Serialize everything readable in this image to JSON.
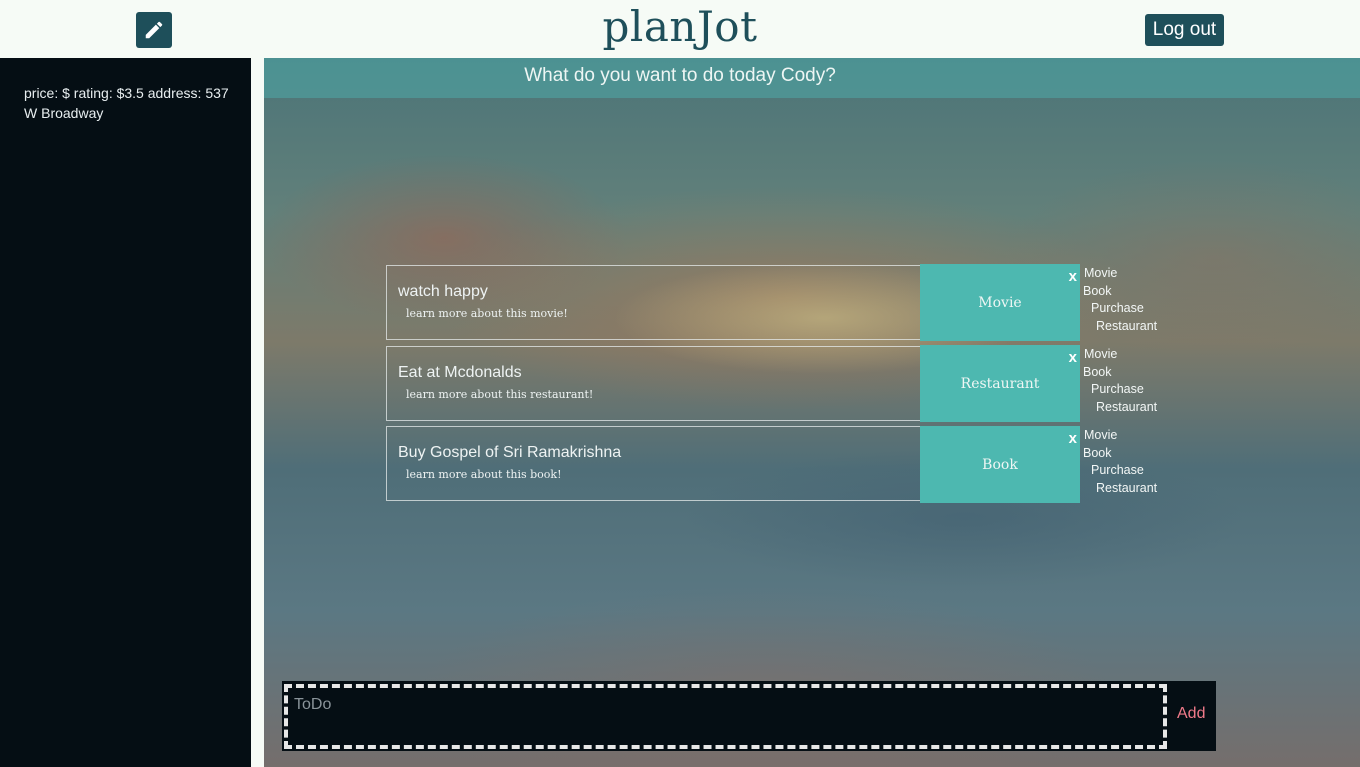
{
  "header": {
    "app_title": "planJot",
    "logout_label": "Log out"
  },
  "sidebar": {
    "info": "price: $ rating: $3.5 address: 537 W Broadway"
  },
  "main": {
    "prompt": "What do you want to do today Cody?"
  },
  "todos": [
    {
      "title": "watch happy",
      "link": "learn more about this movie!",
      "category": "Movie",
      "close": "x"
    },
    {
      "title": "Eat at Mcdonalds",
      "link": "learn more about this restaurant!",
      "category": "Restaurant",
      "close": "x"
    },
    {
      "title": "Buy Gospel of Sri Ramakrishna",
      "link": "learn more about this book!",
      "category": "Book",
      "close": "x"
    }
  ],
  "category_options": [
    "Movie",
    "Book",
    "Purchase",
    "Restaurant"
  ],
  "add_form": {
    "placeholder": "ToDo",
    "add_label": "Add"
  }
}
